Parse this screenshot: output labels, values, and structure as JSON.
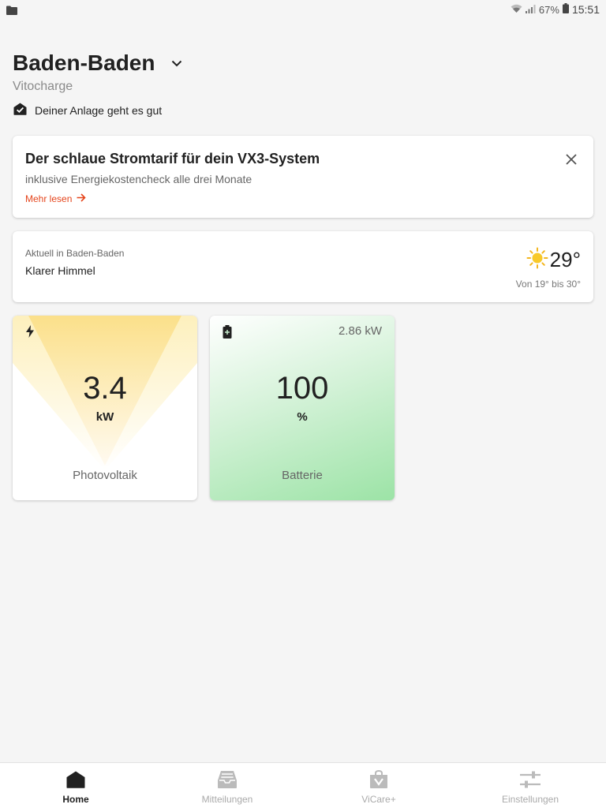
{
  "status_bar": {
    "battery": "67%",
    "time": "15:51"
  },
  "header": {
    "title": "Baden-Baden",
    "subtitle": "Vitocharge",
    "status": "Deiner Anlage geht es gut"
  },
  "promo": {
    "title": "Der schlaue Stromtarif für dein VX3-System",
    "subtitle": "inklusive Energiekostencheck alle drei Monate",
    "link_label": "Mehr lesen",
    "link_color": "#e5441b"
  },
  "weather": {
    "location": "Aktuell in Baden-Baden",
    "condition": "Klarer Himmel",
    "temperature": "29°",
    "range": "Von 19° bis 30°",
    "icon": "sun-icon"
  },
  "tiles": {
    "photovoltaik": {
      "value": "3.4",
      "unit": "kW",
      "label": "Photovoltaik",
      "icon": "lightning-icon"
    },
    "batterie": {
      "power": "2.86 kW",
      "value": "100",
      "unit": "%",
      "label": "Batterie",
      "icon": "battery-icon",
      "color": "#9ce3a6"
    }
  },
  "bottom_nav": {
    "items": [
      {
        "label": "Home",
        "icon": "home-icon",
        "active": true
      },
      {
        "label": "Mitteilungen",
        "icon": "inbox-icon",
        "active": false
      },
      {
        "label": "ViCare+",
        "icon": "shopping-bag-icon",
        "active": false
      },
      {
        "label": "Einstellungen",
        "icon": "settings-sliders-icon",
        "active": false
      }
    ]
  }
}
